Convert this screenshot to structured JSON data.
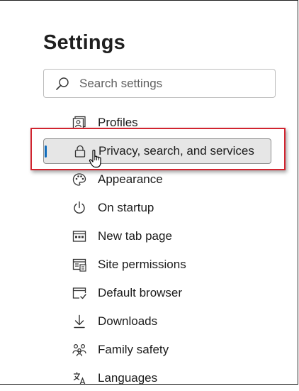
{
  "header": {
    "title": "Settings"
  },
  "search": {
    "placeholder": "Search settings",
    "icon": "search-icon"
  },
  "nav": {
    "items": [
      {
        "label": "Profiles",
        "icon": "profile-icon"
      },
      {
        "label": "Privacy, search, and services",
        "icon": "lock-icon",
        "active": true
      },
      {
        "label": "Appearance",
        "icon": "palette-icon"
      },
      {
        "label": "On startup",
        "icon": "power-icon"
      },
      {
        "label": "New tab page",
        "icon": "new-tab-icon"
      },
      {
        "label": "Site permissions",
        "icon": "site-permissions-icon"
      },
      {
        "label": "Default browser",
        "icon": "default-browser-icon"
      },
      {
        "label": "Downloads",
        "icon": "download-icon"
      },
      {
        "label": "Family safety",
        "icon": "family-icon"
      },
      {
        "label": "Languages",
        "icon": "languages-icon"
      }
    ]
  },
  "colors": {
    "accent": "#0f6cbd",
    "highlight_border": "#d1242f",
    "active_bg": "#e6e6e6"
  }
}
